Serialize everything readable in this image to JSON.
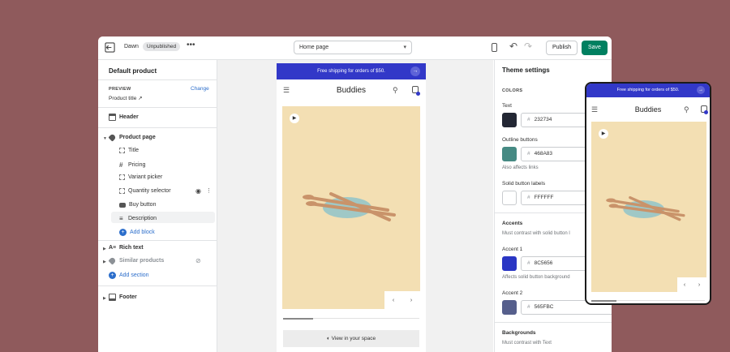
{
  "topbar": {
    "store_name": "Dawn",
    "status_badge": "Unpublished",
    "more_label": "•••",
    "page_select": "Home page",
    "publish_label": "Publish",
    "save_label": "Save"
  },
  "left_panel": {
    "title": "Default product",
    "preview_label": "PREVIEW",
    "change_label": "Change",
    "product_title": "Product title",
    "header_label": "Header",
    "product_page_label": "Product page",
    "blocks": [
      "Title",
      "Pricing",
      "Variant picker",
      "Quantity selector",
      "Buy button",
      "Description"
    ],
    "add_block": "Add block",
    "rich_text": "Rich text",
    "similar_products": "Similar products",
    "add_section": "Add section",
    "footer": "Footer"
  },
  "store_preview": {
    "announcement": "Free shipping for orders of $50.",
    "brand": "Buddies",
    "view_in_space": "View in your space",
    "slider_progress": 0.22
  },
  "theme_settings": {
    "title": "Theme settings",
    "colors_caption": "COLORS",
    "text_label": "Text",
    "text_hex": "232734",
    "outline_label": "Outline buttons",
    "outline_hex": "468A83",
    "outline_note": "Also affects links",
    "solid_label": "Solid button labels",
    "solid_hex": "FFFFFF",
    "accents_title": "Accents",
    "accents_note": "Must contrast with solid button l",
    "accent1_label": "Accent 1",
    "accent1_hex": "8C5656",
    "accent1_note": "Affects solid button background",
    "accent2_label": "Accent 2",
    "accent2_hex": "565FBC",
    "backgrounds_title": "Backgrounds",
    "backgrounds_note": "Must contrast with Text"
  },
  "colors": {
    "text_swatch": "#232734",
    "outline_swatch": "#468A83",
    "solid_swatch": "#FFFFFF",
    "accent1_swatch": "#2a36c4",
    "accent2_swatch": "#565F8C",
    "announcement_bar": "#3238c8",
    "save_button": "#008060"
  }
}
